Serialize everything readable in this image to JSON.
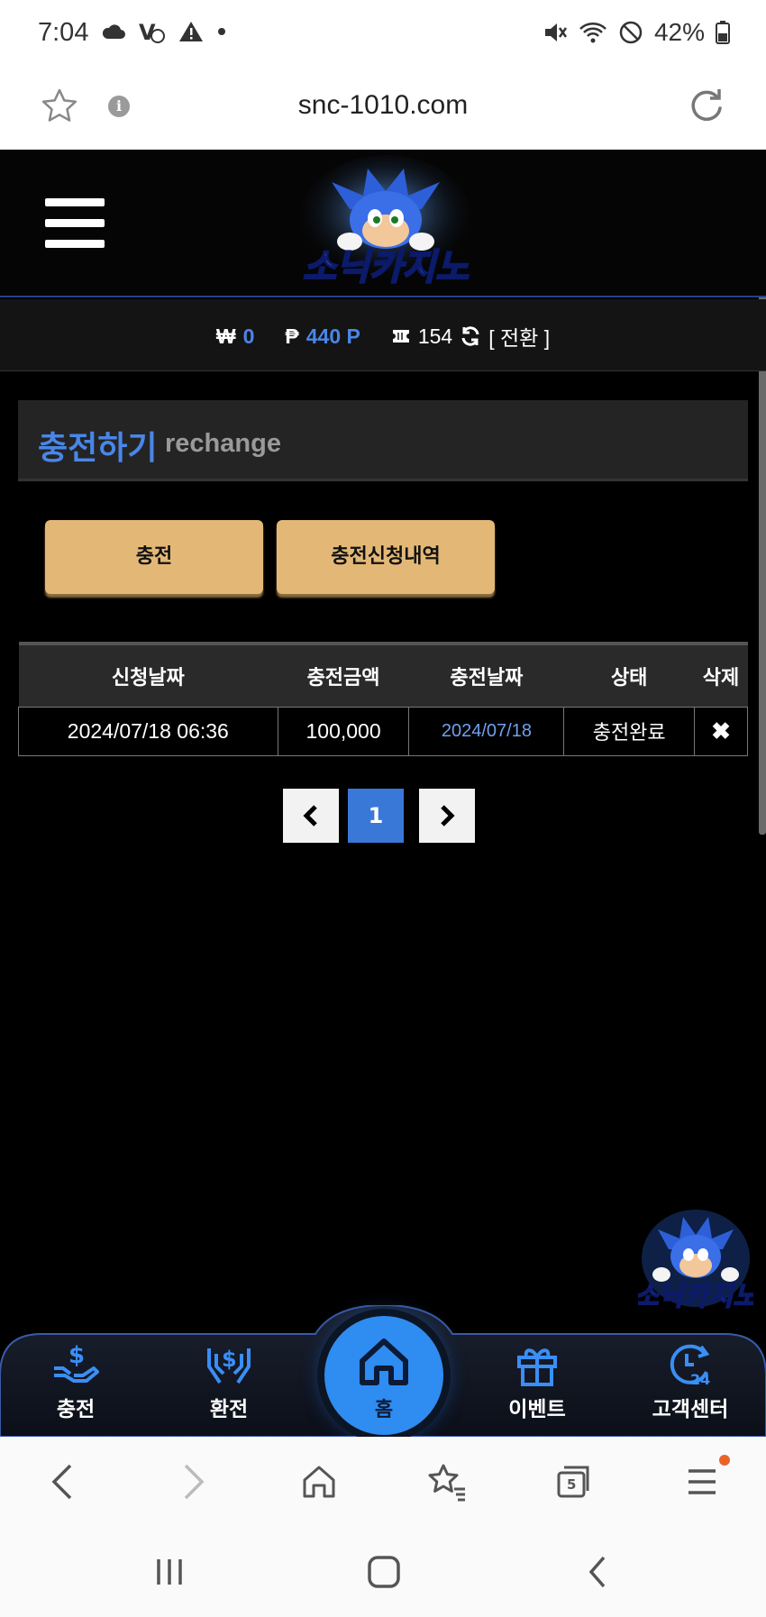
{
  "status_bar": {
    "time": "7:04",
    "left_icons": [
      "cloud-icon",
      "call-icon",
      "warning-icon",
      "dot-icon"
    ],
    "right_icons": [
      "mute-icon",
      "wifi-icon",
      "block-icon"
    ],
    "battery": "42%"
  },
  "url_bar": {
    "url": "snc-1010.com"
  },
  "header": {
    "logo_text": "소닉카지노"
  },
  "balance": {
    "won_symbol": "₩",
    "won_value": "0",
    "point_symbol": "₱",
    "point_value": "440 P",
    "coupon_value": "154",
    "switch_label": "[ 전환 ]"
  },
  "section": {
    "title_ko": "충전하기",
    "title_en": "rechange"
  },
  "buttons": {
    "charge": "충전",
    "history": "충전신청내역"
  },
  "table": {
    "headers": [
      "신청날짜",
      "충전금액",
      "충전날짜",
      "상태",
      "삭제"
    ],
    "rows": [
      {
        "request_date": "2024/07/18 06:36",
        "amount": "100,000",
        "charge_date": "2024/07/18",
        "status": "충전완료"
      }
    ]
  },
  "pager": {
    "current": "1"
  },
  "bottom_nav": {
    "charge": "충전",
    "exchange": "환전",
    "home": "홈",
    "event": "이벤트",
    "support": "고객센터"
  },
  "browser": {
    "tabs_count": "5"
  },
  "colors": {
    "accent_blue": "#4a86e8",
    "gold": "#e3b877",
    "nav_blue": "#2f8cf0"
  }
}
